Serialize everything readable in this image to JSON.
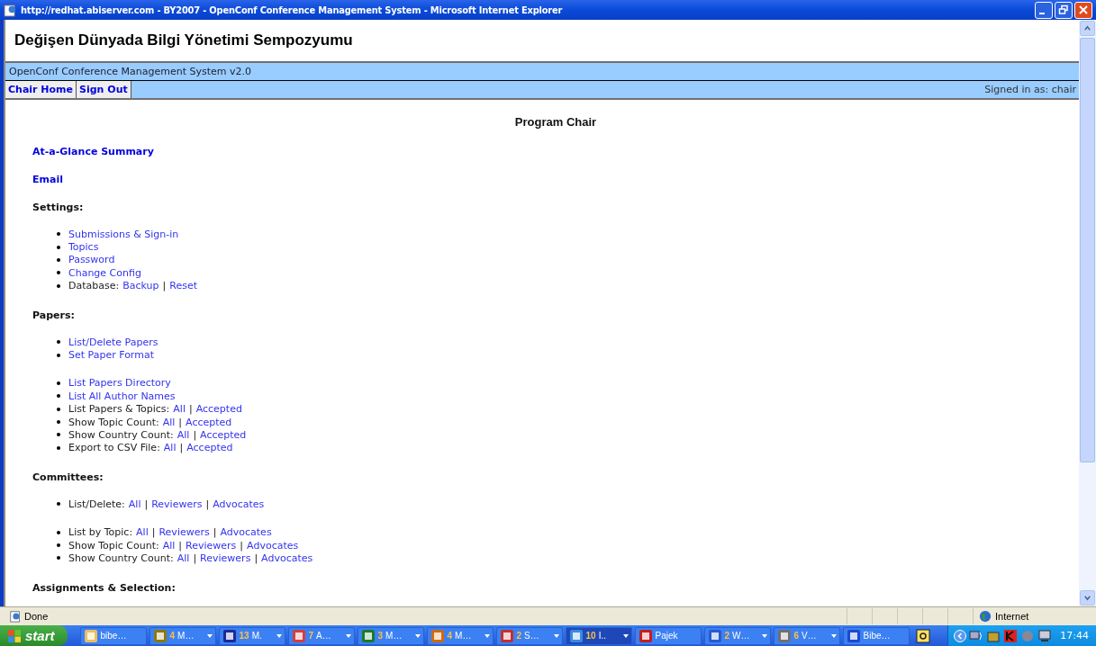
{
  "window": {
    "title": "http://redhat.abiserver.com - BY2007 - OpenConf Conference Management System - Microsoft Internet Explorer"
  },
  "page": {
    "site_title": "Değişen Dünyada Bilgi Yönetimi Sempozyumu",
    "system_name": "OpenConf Conference Management System v2.0",
    "nav": [
      {
        "label": "Chair Home"
      },
      {
        "label": "Sign Out"
      }
    ],
    "signed_in": "Signed in as: chair",
    "heading": "Program Chair",
    "sections": [
      {
        "kind": "link",
        "text": "At-a-Glance Summary"
      },
      {
        "kind": "link",
        "text": "Email"
      },
      {
        "kind": "heading",
        "text": "Settings:",
        "groups": [
          [
            {
              "links": [
                "Submissions & Sign-in"
              ]
            },
            {
              "links": [
                "Topics"
              ]
            },
            {
              "links": [
                "Password"
              ]
            },
            {
              "links": [
                "Change Config"
              ]
            },
            {
              "label": "Database:",
              "links": [
                "Backup",
                "Reset"
              ],
              "separator": "|"
            }
          ]
        ]
      },
      {
        "kind": "heading",
        "text": "Papers:",
        "groups": [
          [
            {
              "links": [
                "List/Delete Papers"
              ]
            },
            {
              "links": [
                "Set Paper Format"
              ]
            }
          ],
          [
            {
              "links": [
                "List Papers Directory"
              ]
            },
            {
              "links": [
                "List All Author Names"
              ]
            },
            {
              "label": "List Papers & Topics:",
              "links": [
                "All",
                "Accepted"
              ],
              "separator": "|"
            },
            {
              "label": "Show Topic Count:",
              "links": [
                "All",
                "Accepted"
              ],
              "separator": "|"
            },
            {
              "label": "Show Country Count:",
              "links": [
                "All",
                "Accepted"
              ],
              "separator": "|"
            },
            {
              "label": "Export to CSV File:",
              "links": [
                "All",
                "Accepted"
              ],
              "separator": "|"
            }
          ]
        ]
      },
      {
        "kind": "heading",
        "text": "Committees:",
        "groups": [
          [
            {
              "label": "List/Delete:",
              "links": [
                "All",
                "Reviewers",
                "Advocates"
              ],
              "separator": "|"
            }
          ],
          [
            {
              "label": "List by Topic:",
              "links": [
                "All",
                "Reviewers",
                "Advocates"
              ],
              "separator": "|"
            },
            {
              "label": "Show Topic Count:",
              "links": [
                "All",
                "Reviewers",
                "Advocates"
              ],
              "separator": "|"
            },
            {
              "label": "Show Country Count:",
              "links": [
                "All",
                "Reviewers",
                "Advocates"
              ],
              "separator": "|"
            }
          ]
        ]
      },
      {
        "kind": "heading",
        "text": "Assignments & Selection:"
      }
    ]
  },
  "status_bar": {
    "status": "Done",
    "zone": "Internet"
  },
  "taskbar": {
    "start": "start",
    "clock": "17:44",
    "items": [
      {
        "kind": "folder",
        "label": "bibe…",
        "menu": false,
        "selected": false
      },
      {
        "kind": "clock",
        "count": "4",
        "label": "M…",
        "menu": true,
        "selected": false
      },
      {
        "kind": "word",
        "count": "13",
        "label": "M.",
        "menu": true,
        "selected": false
      },
      {
        "kind": "pdf",
        "count": "7",
        "label": "A…",
        "menu": true,
        "selected": false
      },
      {
        "kind": "excel",
        "count": "3",
        "label": "M…",
        "menu": true,
        "selected": false
      },
      {
        "kind": "slides",
        "count": "4",
        "label": "M…",
        "menu": true,
        "selected": false
      },
      {
        "kind": "chart",
        "count": "2",
        "label": "S…",
        "menu": true,
        "selected": false
      },
      {
        "kind": "browser",
        "count": "10",
        "label": "I..",
        "menu": true,
        "selected": true
      },
      {
        "kind": "bug",
        "label": "Pajek",
        "menu": false,
        "selected": false
      },
      {
        "kind": "media",
        "count": "2",
        "label": "W…",
        "menu": true,
        "selected": false
      },
      {
        "kind": "doc",
        "count": "6",
        "label": "V…",
        "menu": true,
        "selected": false
      },
      {
        "kind": "logo",
        "label": "Bibe…",
        "menu": false,
        "selected": false
      }
    ]
  }
}
